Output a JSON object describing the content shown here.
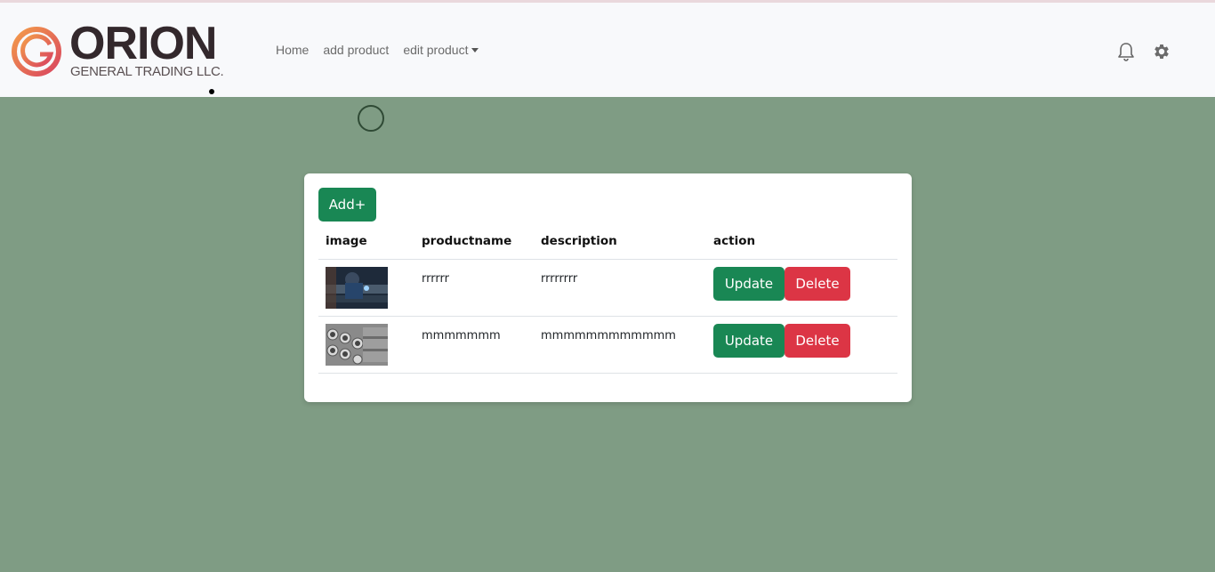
{
  "brand": {
    "name": "ORION",
    "subtitle": "GENERAL TRADING LLC.",
    "colors": {
      "ring_start": "#f39c4a",
      "ring_end": "#d9455f",
      "text": "#33282c"
    }
  },
  "nav": {
    "links": [
      "Home",
      "add product",
      "edit product"
    ],
    "icons": [
      "bell-icon",
      "gear-icon"
    ]
  },
  "table": {
    "add_label": "Add+",
    "headers": [
      "image",
      "productname",
      "description",
      "action"
    ],
    "rows": [
      {
        "image": "product-photo-welder",
        "productname": "rrrrrr",
        "description": "rrrrrrrr",
        "update_label": "Update",
        "delete_label": "Delete"
      },
      {
        "image": "product-photo-pipes",
        "productname": "mmmmmmm",
        "description": "mmmmmmmmmmmm",
        "update_label": "Update",
        "delete_label": "Delete"
      }
    ]
  },
  "colors": {
    "background": "#7f9c84",
    "primary": "#198754",
    "danger": "#dc3545",
    "navbar": "#f8f9fb"
  }
}
